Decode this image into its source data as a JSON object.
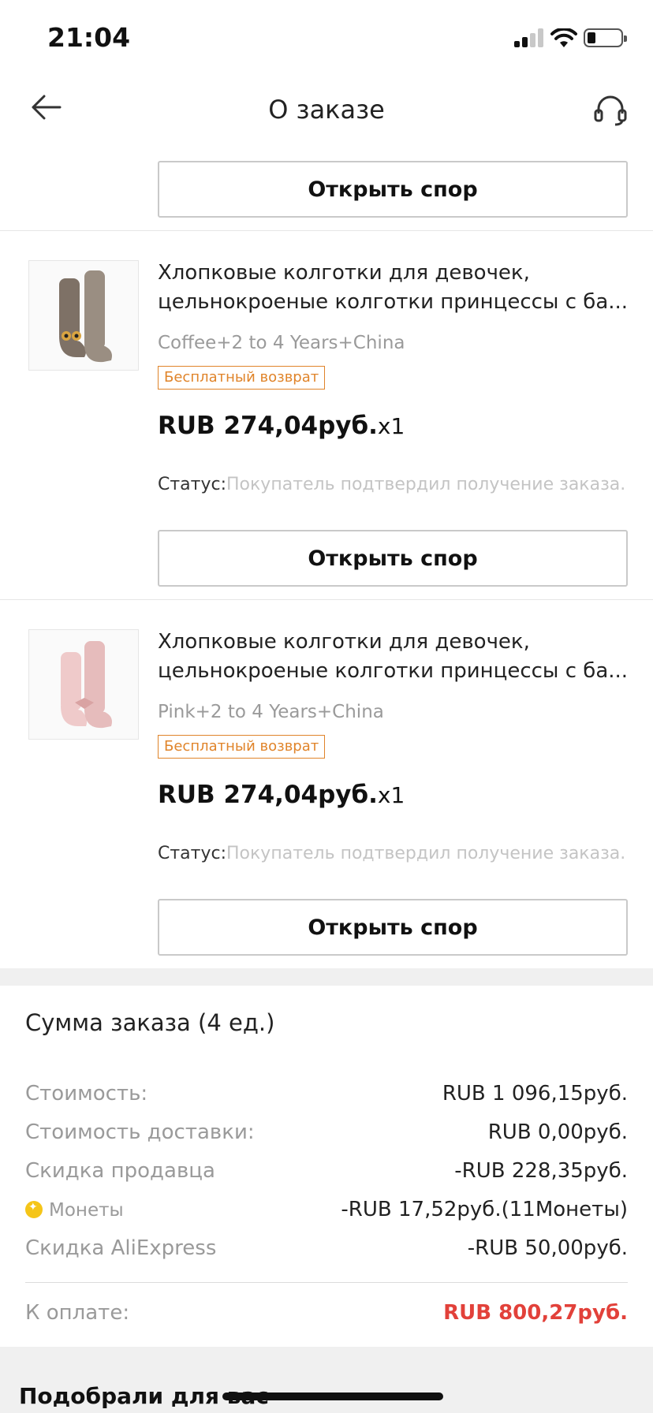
{
  "status_bar": {
    "time": "21:04"
  },
  "header": {
    "title": "О заказе"
  },
  "top_action": {
    "dispute_label": "Открыть спор"
  },
  "items": [
    {
      "title_line1": "Хлопковые колготки для девочек,",
      "title_line2": "цельнокроеные колготки принцессы с ба...",
      "variant": "Coffee+2 to 4 Years+China",
      "badge": "Бесплатный возврат",
      "price": "RUB 274,04руб.",
      "quantity": "x1",
      "status_label": "Статус:",
      "status_value": "Покупатель подтвердил получение заказа.",
      "dispute_label": "Открыть спор",
      "thumb_color": "#8a7d72"
    },
    {
      "title_line1": "Хлопковые колготки для девочек,",
      "title_line2": "цельнокроеные колготки принцессы с ба...",
      "variant": "Pink+2 to 4 Years+China",
      "badge": "Бесплатный возврат",
      "price": "RUB 274,04руб.",
      "quantity": "x1",
      "status_label": "Статус:",
      "status_value": "Покупатель подтвердил получение заказа.",
      "dispute_label": "Открыть спор",
      "thumb_color": "#e8c4c4"
    }
  ],
  "summary": {
    "title": "Сумма заказа (4 ед.)",
    "rows": [
      {
        "label": "Стоимость:",
        "value": "RUB 1 096,15руб."
      },
      {
        "label": "Стоимость доставки:",
        "value": "RUB 0,00руб."
      },
      {
        "label": "Скидка продавца",
        "value": "-RUB 228,35руб."
      },
      {
        "label": "Монеты",
        "value": "-RUB 17,52руб.(11Монеты)"
      },
      {
        "label": "Скидка AliExpress",
        "value": "-RUB 50,00руб."
      }
    ],
    "total_label": "К оплате:",
    "total_value": "RUB 800,27руб."
  },
  "recommendations": {
    "title": "Подобрали для вас"
  },
  "colors": {
    "accent_total": "#e2413a",
    "badge": "#e0842a",
    "coin": "#f5c518"
  }
}
